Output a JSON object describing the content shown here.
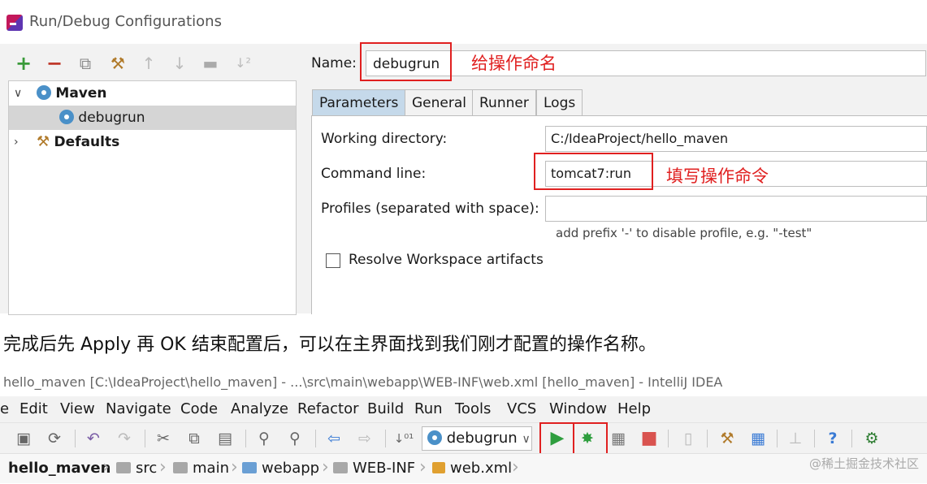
{
  "dialog": {
    "title": "Run/Debug Configurations",
    "toolbar_icons": [
      "add-icon",
      "remove-icon",
      "copy-icon",
      "wrench-icon",
      "arrow-up-icon",
      "arrow-down-icon",
      "folder-icon",
      "sort-icon"
    ],
    "tree": {
      "maven_label": "Maven",
      "debugrun_label": "debugrun",
      "defaults_label": "Defaults"
    },
    "name_label": "Name:",
    "name_value": "debugrun",
    "name_note": "给操作命名",
    "tabs": [
      "Parameters",
      "General",
      "Runner",
      "Logs"
    ],
    "working_dir_label": "Working directory:",
    "working_dir_value": "C:/IdeaProject/hello_maven",
    "command_line_label": "Command line:",
    "command_line_value": "tomcat7:run",
    "command_note": "填写操作命令",
    "profiles_label": "Profiles (separated with space):",
    "profiles_value": "",
    "profiles_hint": "add prefix '-' to disable profile, e.g. \"-test\"",
    "resolve_label": "Resolve Workspace artifacts",
    "accent": "#e02020",
    "tab_active_color": "#c5d9ea"
  },
  "paragraph": "完成后先 Apply 再 OK 结束配置后，可以在主界面找到我们刚才配置的操作名称。",
  "ide": {
    "title": "hello_maven [C:\\IdeaProject\\hello_maven] - ...\\src\\main\\webapp\\WEB-INF\\web.xml [hello_maven] - IntelliJ IDEA",
    "menu": [
      "e",
      "Edit",
      "View",
      "Navigate",
      "Code",
      "Analyze",
      "Refactor",
      "Build",
      "Run",
      "Tools",
      "VCS",
      "Window",
      "Help"
    ],
    "config_selector": "debugrun",
    "breadcrumb": [
      "hello_maven",
      "src",
      "main",
      "webapp",
      "WEB-INF",
      "web.xml"
    ],
    "watermark": "@稀土掘金技术社区"
  }
}
